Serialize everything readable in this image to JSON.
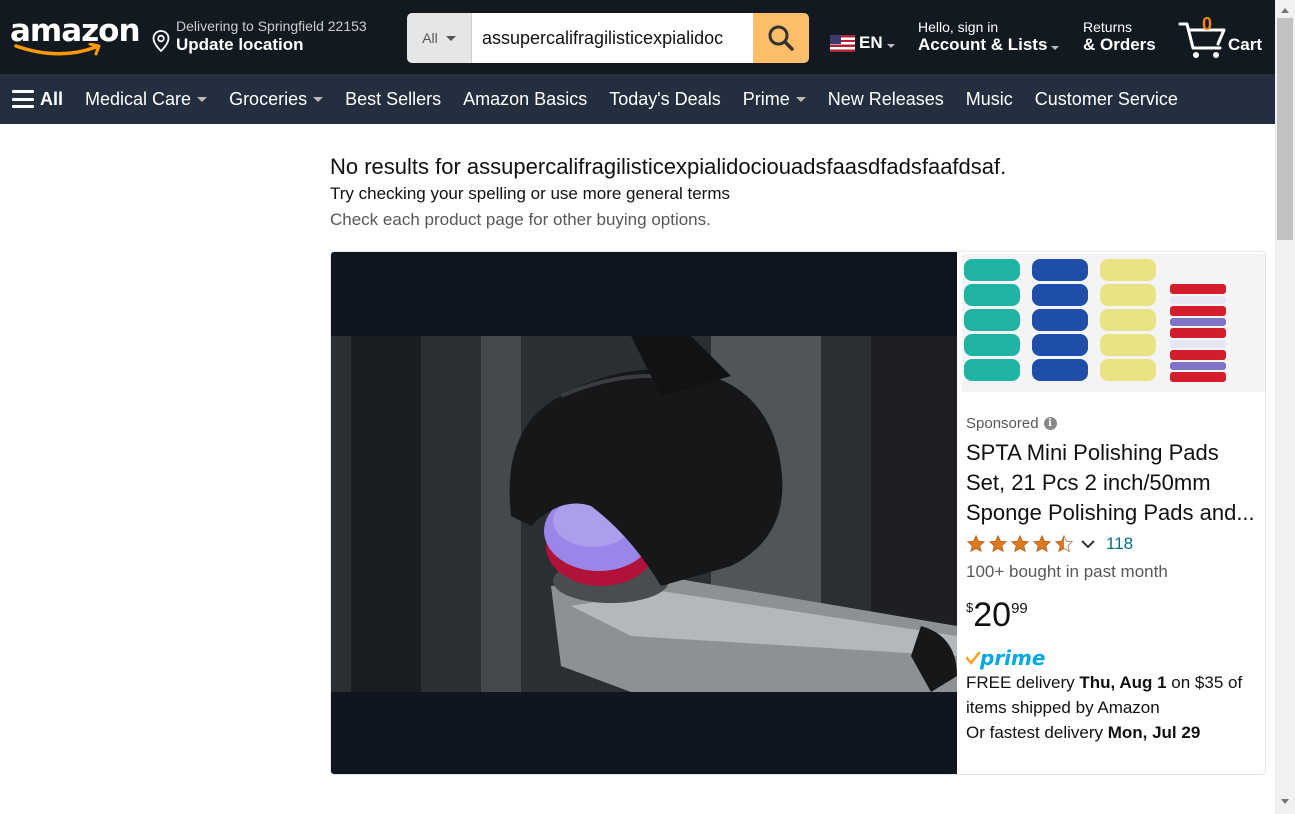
{
  "header": {
    "logo_text": "amazon",
    "location": {
      "line1": "Delivering to Springfield 22153",
      "line2": "Update location"
    },
    "search": {
      "category": "All",
      "query": "assupercalifragilisticexpialidoc"
    },
    "language": "EN",
    "account": {
      "line1": "Hello, sign in",
      "line2": "Account & Lists"
    },
    "returns": {
      "line1": "Returns",
      "line2": "& Orders"
    },
    "cart": {
      "count": "0",
      "label": "Cart"
    }
  },
  "subnav": {
    "all_label": "All",
    "items": [
      "Medical Care",
      "Groceries",
      "Best Sellers",
      "Amazon Basics",
      "Today's Deals",
      "Prime",
      "New Releases",
      "Music",
      "Customer Service"
    ]
  },
  "results": {
    "heading": "No results for assupercalifragilisticexpialidociouadsfaasdfadsfaafdsaf.",
    "suggestion": "Try checking your spelling or use more general terms",
    "note": "Check each product page for other buying options."
  },
  "ad": {
    "sponsored_label": "Sponsored",
    "title": "SPTA Mini Polishing Pads Set, 21 Pcs 2 inch/50mm Sponge Polishing Pads and...",
    "rating_value": 4.5,
    "rating_count": "118",
    "bought": "100+ bought in past month",
    "price": {
      "symbol": "$",
      "whole": "20",
      "fraction": "99"
    },
    "prime_label": "prime",
    "delivery": {
      "prefix": "FREE delivery ",
      "date": "Thu, Aug 1",
      "suffix": " on $35 of items shipped by Amazon",
      "fast_prefix": "Or fastest delivery ",
      "fast_date": "Mon, Jul 29"
    }
  },
  "colors": {
    "nav_dark": "#131921",
    "nav_sub": "#232f3e",
    "search_button": "#febd69",
    "link": "#007185",
    "cart_count": "#f08804",
    "prime": "#00a8e1",
    "star": "#de7921"
  }
}
